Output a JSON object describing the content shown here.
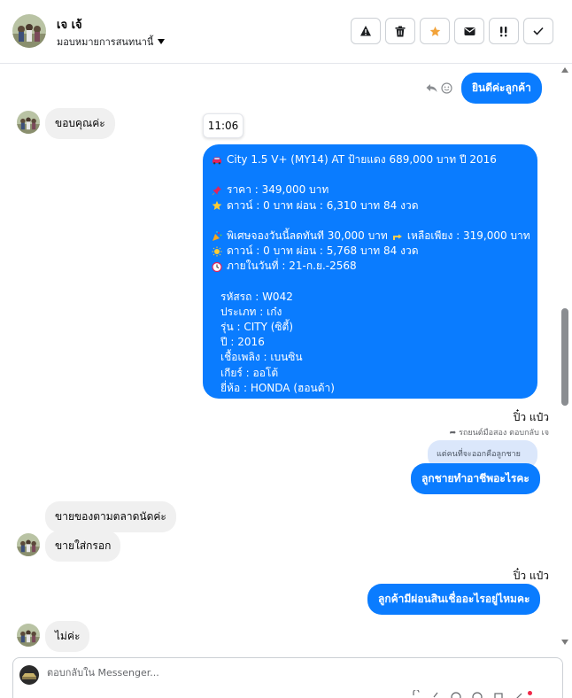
{
  "header": {
    "name": "เจ เจ้",
    "assign_label": "มอบหมายการสนทนานี้",
    "toolbar_icons": [
      "warning-icon",
      "trash-icon",
      "star-icon",
      "mail-icon",
      "double-exclamation-icon",
      "check-icon"
    ],
    "accent": "#f2a33a"
  },
  "messages": {
    "out_1": "ยินดีค่ะลูกค้า",
    "in_1": "ขอบคุณค่ะ",
    "timestamp": "11:06",
    "card": {
      "line_1": "City 1.5 V+ (MY14) AT ป้ายแดง 689,000 บาท ปี 2016",
      "line_2": "ราคา : 349,000 บาท",
      "line_3": "ดาวน์ : 0 บาท ผ่อน : 6,310 บาท 84 งวด",
      "line_4a": "พิเศษจองวันนี้ลดทันที 30,000 บาท",
      "line_4b": "เหลือเพียง : 319,000 บาท",
      "line_5": "ดาวน์ : 0 บาท ผ่อน : 5,768 บาท 84 งวด",
      "line_6": "ภายในวันที่ : 21-ก.ย.-2568",
      "spec_1": "รหัสรถ : W042",
      "spec_2": "ประเภท : เก๋ง",
      "spec_3": "รุ่น : CITY (ซิตี้)",
      "spec_4": "ปี : 2016",
      "spec_5": "เชื้อเพลิง : เบนซิน",
      "spec_6": "เกียร์ : ออโต้",
      "spec_7": "ยี่ห้อ : HONDA (ฮอนด้า)"
    },
    "sender_1": "ปิ๋ว แป๋ว",
    "reply_note": "รถยนต์มือสอง ตอบกลับ เจ",
    "quoted": "แต่คนที่จะออกคือลูกชาย",
    "out_2": "ลูกชายทำอาชีพอะไรคะ",
    "in_2": "ขายของตามตลาดนัดค่ะ",
    "in_3": "ขายใส่กรอก",
    "sender_2": "ปิ๋ว แป๋ว",
    "out_3": "ลูกค้ามีผ่อนสินเชื่ออะไรอยู่ไหมคะ",
    "in_4": "ไม่ค่ะ"
  },
  "composer": {
    "placeholder": "ตอบกลับใน Messenger..."
  },
  "colors": {
    "bubble_out": "#0a7cff",
    "bubble_in": "#f0f0f0",
    "quoted_bg": "#dbe7fb"
  }
}
